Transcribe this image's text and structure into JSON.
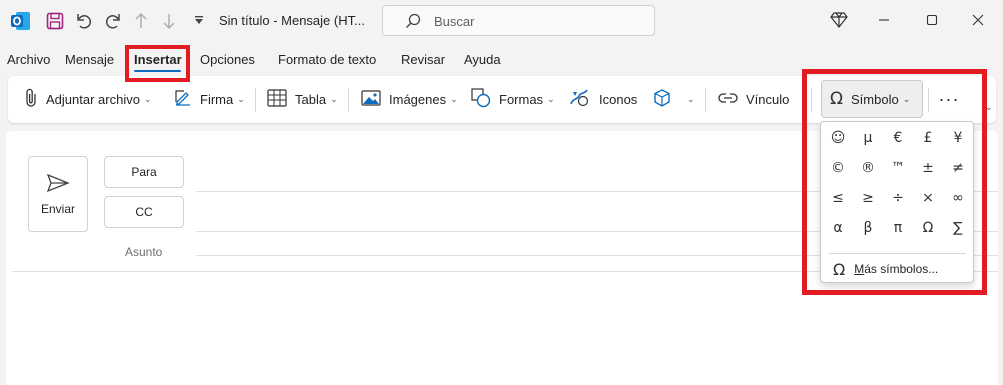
{
  "titlebar": {
    "title": "Sin título  -  Mensaje (HT...",
    "search_placeholder": "Buscar",
    "icons": [
      "outlook-app-icon",
      "save-icon",
      "undo-icon",
      "redo-icon",
      "arrow-up-icon",
      "arrow-down-icon",
      "quick-access-icon",
      "diamond-icon",
      "minimize-icon",
      "maximize-icon",
      "close-icon"
    ]
  },
  "tabs": [
    "Archivo",
    "Mensaje",
    "Insertar",
    "Opciones",
    "Formato de texto",
    "Revisar",
    "Ayuda"
  ],
  "active_tab": "Insertar",
  "ribbon": {
    "attach": "Adjuntar archivo",
    "signature": "Firma",
    "table": "Tabla",
    "images": "Imágenes",
    "shapes": "Formas",
    "icons": "Iconos",
    "link": "Vínculo",
    "symbol": "Símbolo"
  },
  "compose": {
    "send": "Enviar",
    "to": "Para",
    "cc": "CC",
    "subject": "Asunto"
  },
  "symbol_menu": {
    "symbols": [
      "☺",
      "µ",
      "€",
      "£",
      "¥",
      "©",
      "®",
      "™",
      "±",
      "≠",
      "≤",
      "≥",
      "÷",
      "×",
      "∞",
      "α",
      "β",
      "π",
      "Ω",
      "∑"
    ],
    "more_prefix": "M",
    "more_rest": "ás símbolos..."
  },
  "colors": {
    "accent": "#0f6cbd",
    "highlight": "#e31b23",
    "outlook_blue": "#0f6cbd",
    "save_purple": "#a4267d"
  }
}
